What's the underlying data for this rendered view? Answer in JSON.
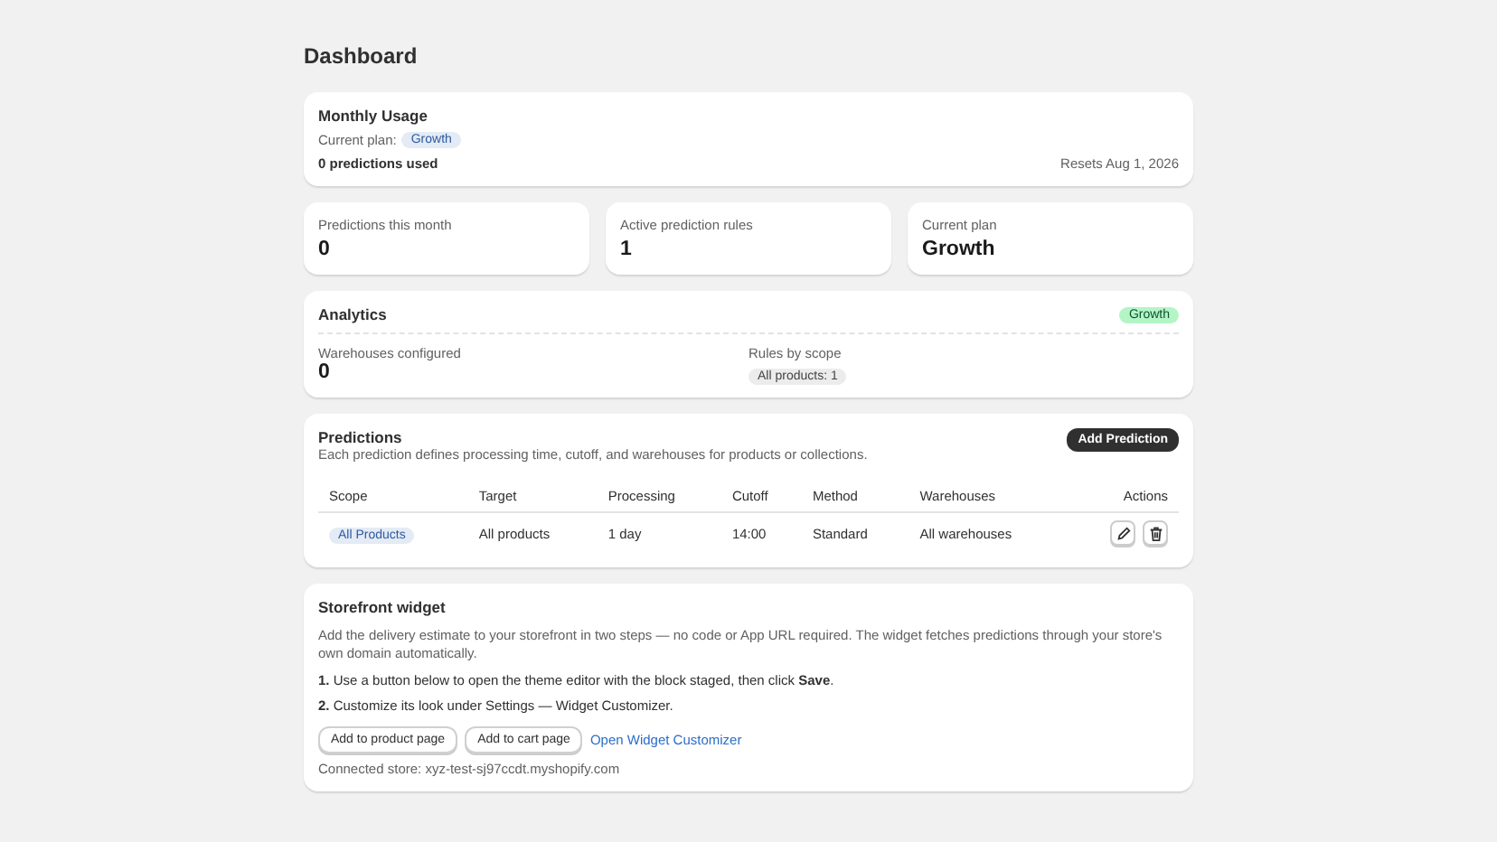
{
  "page_title": "Dashboard",
  "usage": {
    "title": "Monthly Usage",
    "plan_label": "Current plan:",
    "plan_badge": "Growth",
    "used": "0 predictions used",
    "resets": "Resets Aug 1, 2026"
  },
  "stats": [
    {
      "label": "Predictions this month",
      "value": "0"
    },
    {
      "label": "Active prediction rules",
      "value": "1"
    },
    {
      "label": "Current plan",
      "value": "Growth"
    }
  ],
  "analytics": {
    "title": "Analytics",
    "badge": "Growth",
    "warehouses_label": "Warehouses configured",
    "warehouses_value": "0",
    "scope_label": "Rules by scope",
    "scope_tags": [
      "All products: 1"
    ]
  },
  "predictions": {
    "title": "Predictions",
    "description": "Each prediction defines processing time, cutoff, and warehouses for products or collections.",
    "add_button": "Add Prediction",
    "columns": [
      "Scope",
      "Target",
      "Processing",
      "Cutoff",
      "Method",
      "Warehouses",
      "Actions"
    ],
    "rows": [
      {
        "scope": "All Products",
        "target": "All products",
        "processing": "1 day",
        "cutoff": "14:00",
        "method": "Standard",
        "warehouses": "All warehouses"
      }
    ]
  },
  "widget": {
    "title": "Storefront widget",
    "description": "Add the delivery estimate to your storefront in two steps — no code or App URL required. The widget fetches predictions through your store's own domain automatically.",
    "steps": [
      "**1.** Use a button below to open the theme editor with the block staged, then click **Save**.",
      "**2.** Customize its look under Settings — Widget Customizer."
    ],
    "buttons": [
      "Add to product page",
      "Add to cart page"
    ],
    "link": "Open Widget Customizer",
    "connected": "Connected store: xyz-test-sj97ccdt.myshopify.com"
  }
}
